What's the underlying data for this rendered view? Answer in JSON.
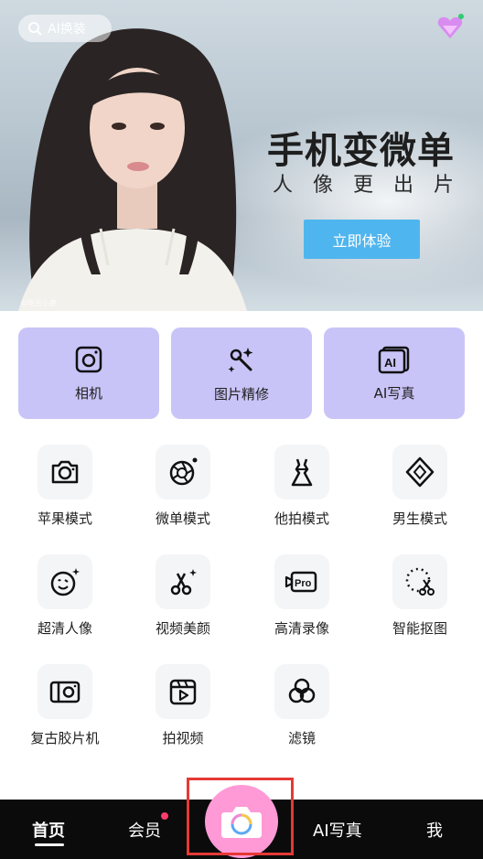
{
  "banner": {
    "search_label": "AI换装",
    "headline": "手机变微单",
    "subline": "人像更出片",
    "cta_label": "立即体验",
    "watermark": "©吃豆小鹿"
  },
  "primary_cards": [
    {
      "label": "相机",
      "icon": "camera-icon"
    },
    {
      "label": "图片精修",
      "icon": "magic-wand-icon"
    },
    {
      "label": "AI写真",
      "icon": "ai-photo-icon"
    }
  ],
  "tools": [
    {
      "label": "苹果模式",
      "icon": "camera-outline-icon"
    },
    {
      "label": "微单模式",
      "icon": "aperture-icon"
    },
    {
      "label": "他拍模式",
      "icon": "dress-icon"
    },
    {
      "label": "男生模式",
      "icon": "diamond-icon"
    },
    {
      "label": "超清人像",
      "icon": "smile-face-icon"
    },
    {
      "label": "视频美颜",
      "icon": "scissors-sparkle-icon"
    },
    {
      "label": "高清录像",
      "icon": "pro-video-icon"
    },
    {
      "label": "智能抠图",
      "icon": "cutout-icon"
    },
    {
      "label": "复古胶片机",
      "icon": "film-camera-icon"
    },
    {
      "label": "拍视频",
      "icon": "clapper-icon"
    },
    {
      "label": "滤镜",
      "icon": "filter-circles-icon"
    }
  ],
  "bottom_nav": {
    "home": "首页",
    "vip": "会员",
    "ai": "AI写真",
    "me": "我"
  },
  "colors": {
    "card_bg": "#c9c4f7",
    "cta": "#4fb5ee",
    "camera_button": "#ff9ad7",
    "nav_bg": "#0b0b0b",
    "notification_dot": "#ff3b6b",
    "highlight": "#e53935"
  }
}
